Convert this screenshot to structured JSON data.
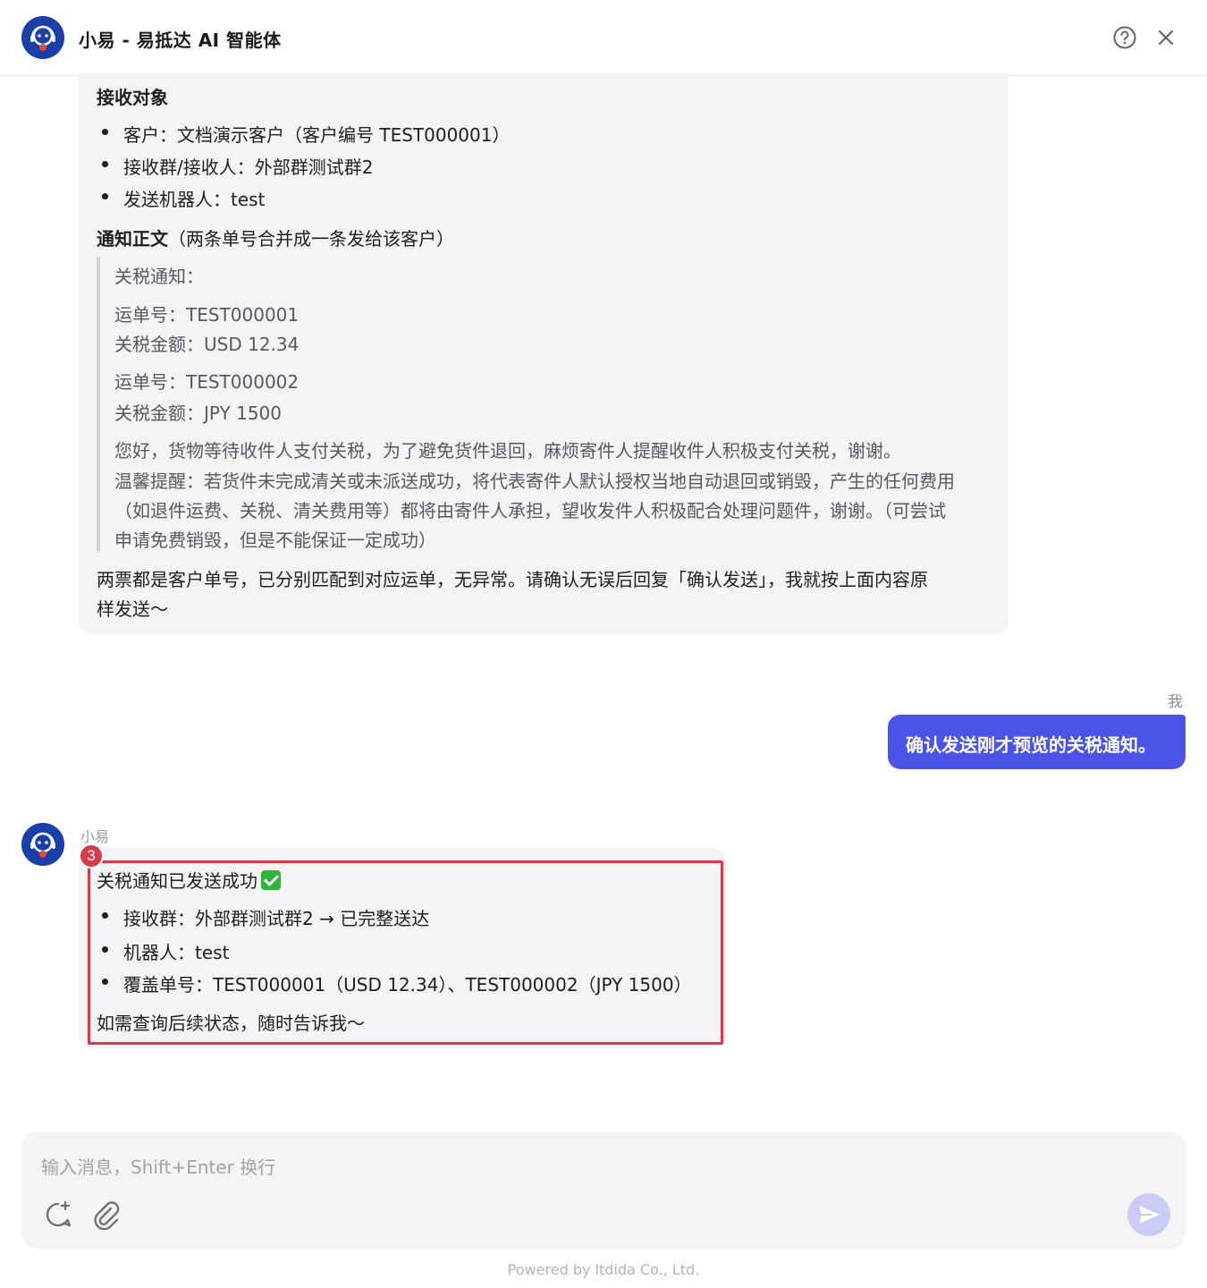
{
  "header": {
    "title": "小易 - 易抵达 AI 智能体"
  },
  "message1": {
    "recipients_heading": "接收对象",
    "recipients": [
      "客户：文档演示客户（客户编号 TEST000001）",
      "接收群/接收人：外部群测试群2",
      "发送机器人：test"
    ],
    "body_heading": "通知正文",
    "body_heading_note": "（两条单号合并成一条发给该客户）",
    "quote": {
      "title": "关税通知：",
      "waybill1": "运单号：TEST000001",
      "amount1": "关税金额：USD 12.34",
      "waybill2": "运单号：TEST000002",
      "amount2": "关税金额：JPY 1500",
      "para1": "您好，货物等待收件人支付关税，为了避免货件退回，麻烦寄件人提醒收件人积极支付关税，谢谢。",
      "para2_line1": "温馨提醒：若货件未完成清关或未派送成功，将代表寄件人默认授权当地自动退回或销毁，产生的任何费用",
      "para2_line2": "（如退件运费、关税、清关费用等）都将由寄件人承担，望收发件人积极配合处理问题件，谢谢。（可尝试",
      "para2_line3": "申请免费销毁，但是不能保证一定成功）"
    },
    "closing_line1": "两票都是客户单号，已分别匹配到对应运单，无异常。请确认无误后回复「确认发送」，我就按上面内容原",
    "closing_line2": "样发送～"
  },
  "user_message": {
    "sender": "我",
    "text": "确认发送刚才预览的关税通知。"
  },
  "message2": {
    "sender": "小易",
    "marker": "3",
    "title": "关税通知已发送成功",
    "items": [
      "接收群：外部群测试群2 → 已完整送达",
      "机器人：test",
      "覆盖单号：TEST000001（USD 12.34）、TEST000002（JPY 1500）"
    ],
    "closing": "如需查询后续状态，随时告诉我～"
  },
  "input": {
    "placeholder": "输入消息，Shift+Enter 换行"
  },
  "footer": {
    "text": "Powered by ltdida Co., Ltd."
  },
  "colors": {
    "accent": "#4a55e8",
    "highlight": "#d73a4a",
    "avatar_bg": "#1a3fa8"
  }
}
